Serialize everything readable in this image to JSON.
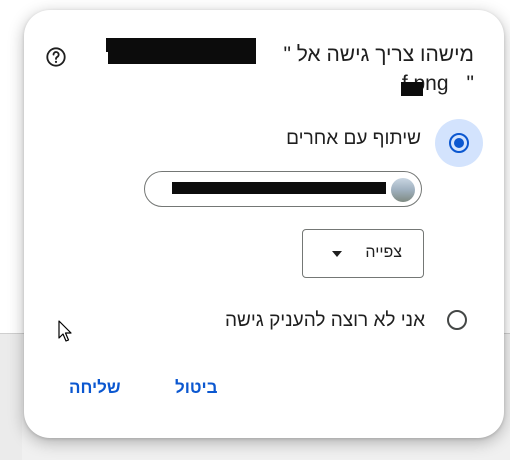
{
  "dialog": {
    "title_line1": "מישהו צריך גישה אל \"",
    "title_line2_suffix": "f.png",
    "title_line2_prefix": "\"",
    "help_icon": "help-circle-icon",
    "share_option": {
      "label": "שיתוף עם אחרים",
      "selected": true
    },
    "recipient_chip": {
      "avatar_icon": "landscape-avatar-icon"
    },
    "role_select": {
      "selected": "צפייה",
      "arrow_icon": "dropdown-arrow-icon"
    },
    "deny_option": {
      "label": "אני לא רוצה להעניק גישה",
      "selected": false
    },
    "buttons": {
      "cancel": "ביטול",
      "send": "שליחה"
    }
  },
  "colors": {
    "accent": "#0b57d0",
    "selected_halo": "#d3e3fd",
    "text": "#1f1f1f",
    "outline": "#747775"
  }
}
